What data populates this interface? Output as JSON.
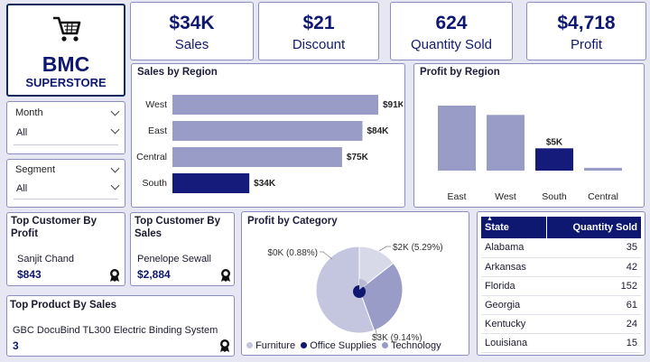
{
  "logo": {
    "title": "BMC",
    "subtitle": "SUPERSTORE"
  },
  "kpis": [
    {
      "value": "$34K",
      "label": "Sales"
    },
    {
      "value": "$21",
      "label": "Discount"
    },
    {
      "value": "624",
      "label": "Quantity Sold"
    },
    {
      "value": "$4,718",
      "label": "Profit"
    }
  ],
  "filters": {
    "month": {
      "label": "Month",
      "value": "All"
    },
    "segment": {
      "label": "Segment",
      "value": "All"
    }
  },
  "colors": {
    "accent": "#0f1870",
    "bar_light": "#9a9cc8",
    "bar_dark": "#151b7a",
    "pie_furniture": "#c4c5df",
    "pie_office": "#0f1870",
    "pie_technology": "#9a9cc8"
  },
  "sales_by_region": {
    "title": "Sales by Region",
    "chart_data": {
      "type": "bar",
      "orientation": "horizontal",
      "categories": [
        "West",
        "East",
        "Central",
        "South"
      ],
      "values": [
        91,
        84,
        75,
        34
      ],
      "labels": [
        "$91K",
        "$84K",
        "$75K",
        "$34K"
      ],
      "unit": "$K",
      "highlight": "South"
    }
  },
  "profit_by_region": {
    "title": "Profit by Region",
    "chart_data": {
      "type": "bar",
      "categories": [
        "East",
        "West",
        "South",
        "Central"
      ],
      "values": [
        35,
        30,
        12,
        1.5
      ],
      "labels": [
        "",
        "",
        "$5K",
        ""
      ],
      "highlight": "South"
    }
  },
  "top_customer_profit": {
    "title": "Top Customer By Profit",
    "name": "Sanjit Chand",
    "value": "$843"
  },
  "top_customer_sales": {
    "title": "Top Customer By Sales",
    "name": "Penelope Sewall",
    "value": "$2,884"
  },
  "top_product": {
    "title": "Top Product By Sales",
    "name": "GBC DocuBind TL300 Electric Binding System",
    "value": "3"
  },
  "profit_by_category": {
    "title": "Profit by Category",
    "chart_data": {
      "type": "pie",
      "categories": [
        "Furniture",
        "Office Supplies",
        "Technology"
      ],
      "labels": [
        "$0K (0.88%)",
        "$2K (5.29%)",
        "$3K (9.14%)"
      ],
      "values": [
        0.88,
        5.29,
        9.14
      ]
    }
  },
  "state_table": {
    "headers": [
      "State",
      "Quantity Sold"
    ],
    "rows": [
      [
        "Alabama",
        "35"
      ],
      [
        "Arkansas",
        "42"
      ],
      [
        "Florida",
        "152"
      ],
      [
        "Georgia",
        "61"
      ],
      [
        "Kentucky",
        "24"
      ],
      [
        "Louisiana",
        "15"
      ]
    ]
  }
}
